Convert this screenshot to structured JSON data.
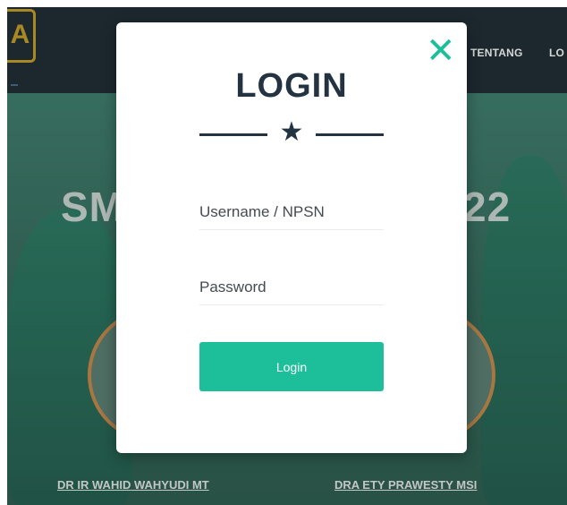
{
  "navbar": {
    "items": [
      "TENTANG",
      "LO"
    ]
  },
  "hero": {
    "title_left": "SM",
    "title_right": "22",
    "people": [
      "DR IR WAHID WAHYUDI MT",
      "DRA ETY PRAWESTY MSI"
    ]
  },
  "modal": {
    "title": "LOGIN",
    "close_icon": "close-icon",
    "divider_icon": "star-icon",
    "username_placeholder": "Username / NPSN",
    "password_placeholder": "Password",
    "submit_label": "Login"
  },
  "colors": {
    "accent": "#1dbf9a",
    "title": "#233342",
    "navbar": "#1e2a33"
  }
}
